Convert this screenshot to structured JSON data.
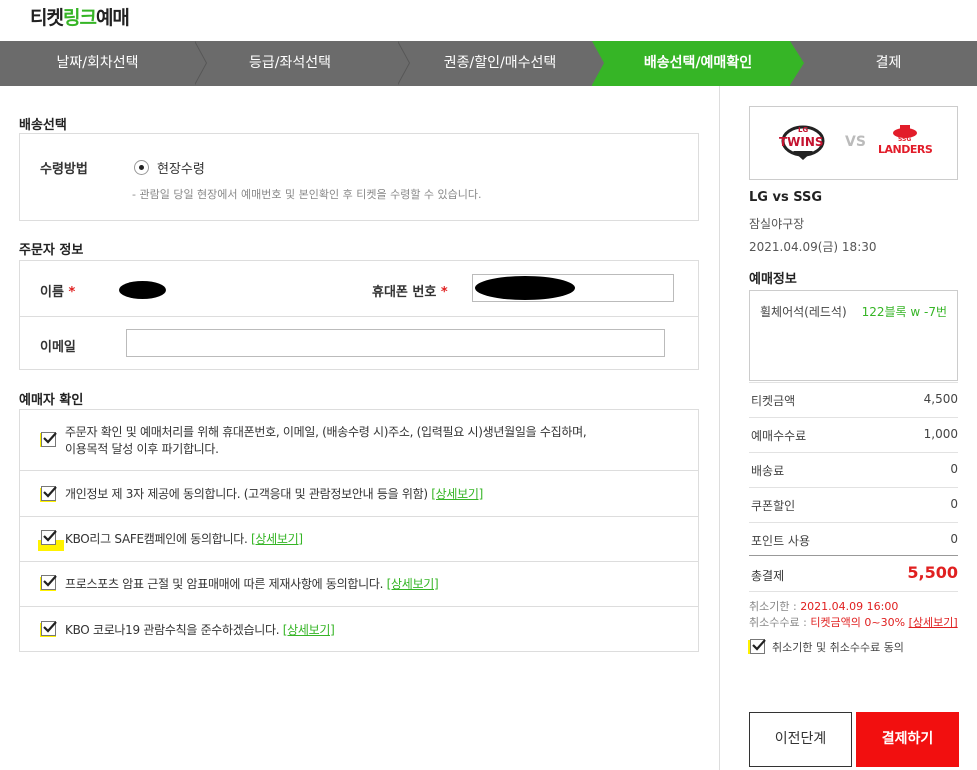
{
  "header": {
    "logo_part1": "티켓",
    "logo_part2": "링크",
    "logo_part3": "예매"
  },
  "steps": [
    {
      "label": "날짜/회차선택",
      "active": false
    },
    {
      "label": "등급/좌석선택",
      "active": false
    },
    {
      "label": "권종/할인/매수선택",
      "active": false
    },
    {
      "label": "배송선택/예매확인",
      "active": true
    },
    {
      "label": "결제",
      "active": false
    }
  ],
  "delivery": {
    "section_title": "배송선택",
    "method_label": "수령방법",
    "option_label": "현장수령",
    "note": "- 관람일 당일 현장에서 예매번호 및 본인확인 후 티켓을 수령할 수 있습니다."
  },
  "orderer": {
    "section_title": "주문자 정보",
    "name_label": "이름",
    "phone_label": "휴대폰 번호",
    "required_mark": "*",
    "email_label": "이메일",
    "email_value": ""
  },
  "agreement": {
    "section_title": "예매자 확인",
    "detail_link": "[상세보기]",
    "items": [
      {
        "line1": "주문자 확인 및 예매처리를 위해 휴대폰번호, 이메일, (배송수령 시)주소, (입력필요 시)생년월일을 수집하며,",
        "line2": "이용목적 달성 이후 파기합니다."
      },
      {
        "text": "개인정보 제 3자 제공에 동의합니다. (고객응대 및 관람정보안내 등을 위함)"
      },
      {
        "text": "KBO리그 SAFE캠페인에 동의합니다."
      },
      {
        "text": "프로스포츠 암표 근절 및 암표매매에 따른 제재사항에 동의합니다."
      },
      {
        "text": "KBO 코로나19 관람수칙을 준수하겠습니다."
      }
    ]
  },
  "summary": {
    "team_home_top": "LG",
    "team_home": "TWINS",
    "vs": "VS",
    "team_away_top": "SSG",
    "team_away": "LANDERS",
    "match_title": "LG vs SSG",
    "venue": "잠실야구장",
    "datetime": "2021.04.09(금) 18:30",
    "booking_info_title": "예매정보",
    "seat_grade": "휠체어석(레드석)",
    "seat_position": "122블록 w -7번",
    "fees": [
      {
        "label": "티켓금액",
        "value": "4,500"
      },
      {
        "label": "예매수수료",
        "value": "1,000"
      },
      {
        "label": "배송료",
        "value": "0"
      },
      {
        "label": "쿠폰할인",
        "value": "0"
      },
      {
        "label": "포인트 사용",
        "value": "0"
      }
    ],
    "total_label": "총결제",
    "total_value": "5,500",
    "cancel_deadline_label": "취소기한 : ",
    "cancel_deadline_value": "2021.04.09 16:00",
    "cancel_fee_label": "취소수수료 : ",
    "cancel_fee_value": "티켓금액의 0~30%",
    "cancel_fee_link": "[상세보기]",
    "cancel_agree": "취소기한 및 취소수수료 동의",
    "prev_button": "이전단계",
    "pay_button": "결제하기"
  },
  "colors": {
    "accent_green": "#36b526",
    "step_gray": "#6b6b6b",
    "pay_red": "#f20f0f",
    "highlight_yellow": "#fff200"
  }
}
